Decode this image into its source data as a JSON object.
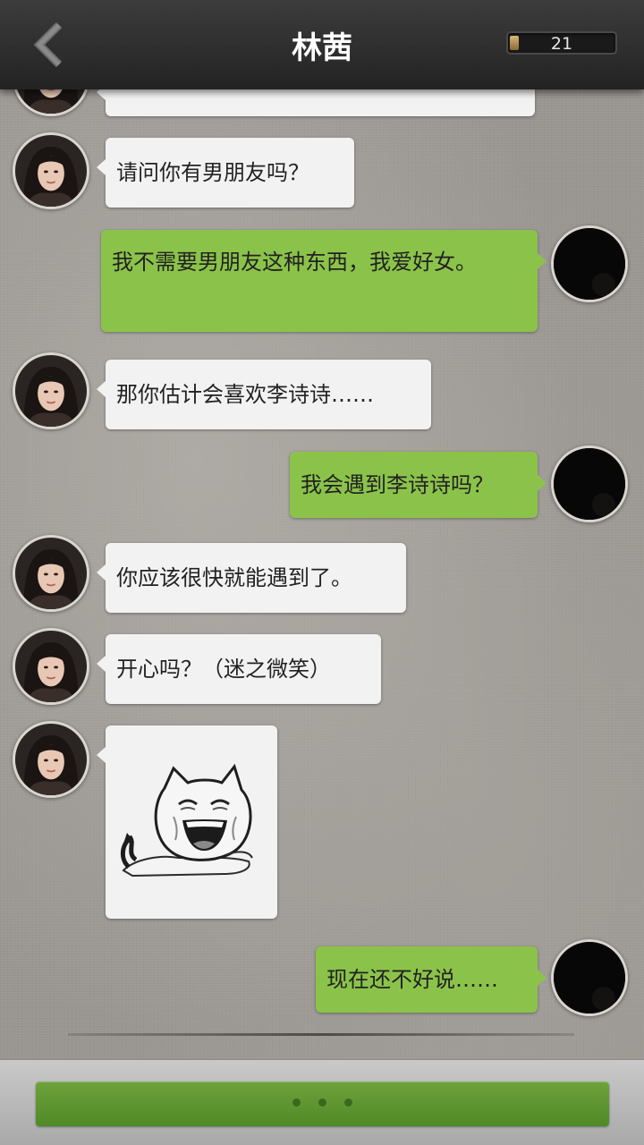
{
  "header": {
    "title": "林茜",
    "counter_value": "21",
    "back_icon": "chevron-left-icon"
  },
  "messages": [
    {
      "side": "left",
      "type": "text",
      "text": "请问你有男朋友吗？"
    },
    {
      "side": "right",
      "type": "text",
      "text": "我不需要男朋友这种东西，我爱好女。"
    },
    {
      "side": "left",
      "type": "text",
      "text": "那你估计会喜欢李诗诗……"
    },
    {
      "side": "right",
      "type": "text",
      "text": "我会遇到李诗诗吗？"
    },
    {
      "side": "left",
      "type": "text",
      "text": "你应该很快就能遇到了。"
    },
    {
      "side": "left",
      "type": "text",
      "text": "开心吗？（迷之微笑）"
    },
    {
      "side": "left",
      "type": "sticker",
      "icon": "laughing-cat-sticker-icon"
    },
    {
      "side": "right",
      "type": "text",
      "text": "现在还不好说……"
    }
  ],
  "footer": {
    "continue_icon": "ellipsis-dots-icon"
  },
  "colors": {
    "header_bg": "#2e2e2e",
    "bubble_left": "#f2f2f2",
    "bubble_right": "#8bc34a",
    "continue_button": "#5a9630"
  }
}
